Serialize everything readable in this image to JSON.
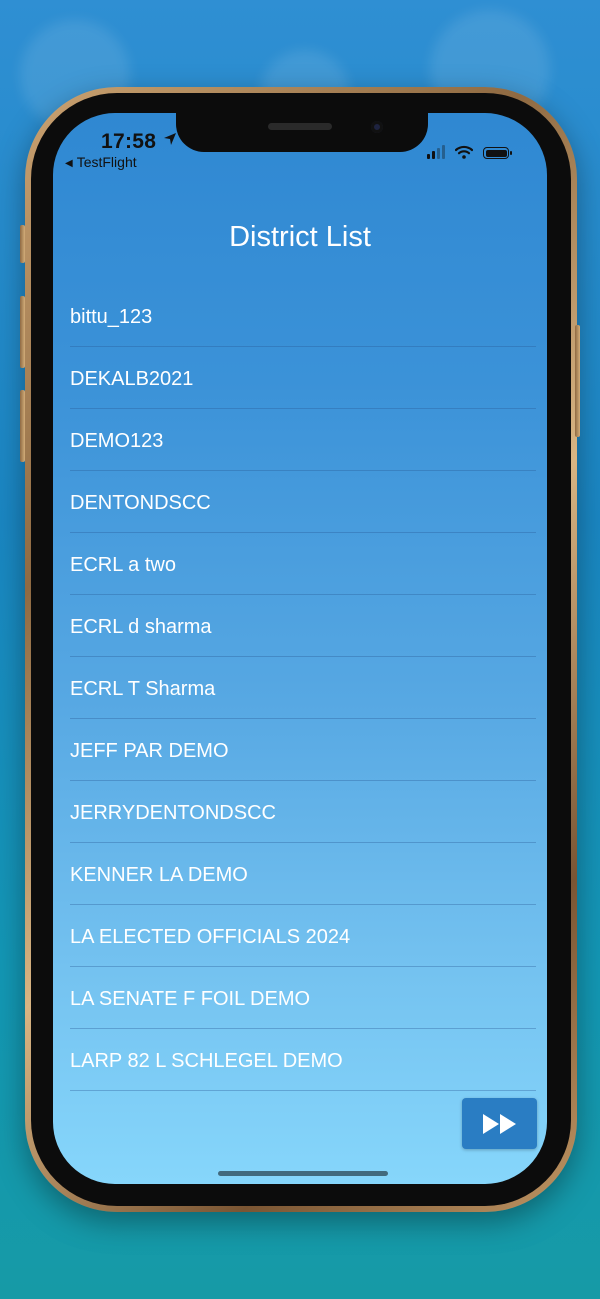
{
  "status_bar": {
    "time": "17:58",
    "back_app": "TestFlight"
  },
  "page": {
    "title": "District List"
  },
  "districts": [
    "bittu_123",
    "DEKALB2021",
    "DEMO123",
    "DENTONDSCC",
    "ECRL a two",
    "ECRL d sharma",
    "ECRL T Sharma",
    "JEFF PAR DEMO",
    "JERRYDENTONDSCC",
    "KENNER LA DEMO",
    "LA ELECTED OFFICIALS 2024",
    "LA SENATE F FOIL DEMO",
    "LARP 82 L SCHLEGEL DEMO"
  ],
  "next_button": {
    "icon": "fast-forward-icon"
  },
  "colors": {
    "accent": "#2a7dc3",
    "text": "#ffffff"
  }
}
